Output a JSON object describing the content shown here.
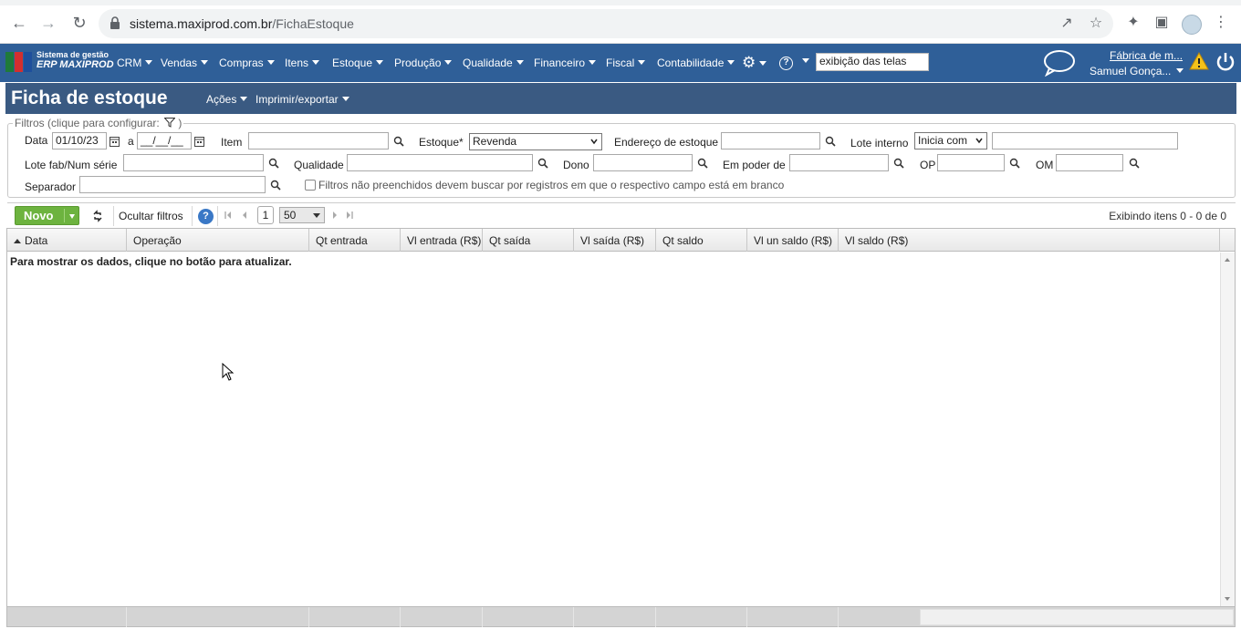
{
  "browser": {
    "url_host": "sistema.maxiprod.com.br",
    "url_path": "/FichaEstoque"
  },
  "app": {
    "logo_line1": "Sistema de gestão",
    "logo_line2": "ERP MAXIPROD",
    "menu": [
      "CRM",
      "Vendas",
      "Compras",
      "Itens",
      "Estoque",
      "Produção",
      "Qualidade",
      "Financeiro",
      "Fiscal",
      "Contabilidade"
    ],
    "nav_search_value": "exibição das telas",
    "company": "Fábrica de m...",
    "user": "Samuel Gonça..."
  },
  "page": {
    "title": "Ficha de estoque",
    "actions_label": "Ações",
    "print_label": "Imprimir/exportar"
  },
  "filters": {
    "legend": "Filtros (clique para configurar:",
    "legend_close": ")",
    "data_label": "Data",
    "data_from": "01/10/23",
    "data_to_sep": "a",
    "data_to": "__/__/__",
    "item_label": "Item",
    "estoque_label": "Estoque*",
    "estoque_value": "Revenda",
    "endereco_label": "Endereço de estoque",
    "lote_interno_label": "Lote interno",
    "lote_interno_mode": "Inicia com",
    "lote_fab_label": "Lote fab/Num série",
    "qualidade_label": "Qualidade",
    "dono_label": "Dono",
    "em_poder_label": "Em poder de",
    "op_label": "OP",
    "om_label": "OM",
    "separador_label": "Separador",
    "blank_filter_label": "Filtros não preenchidos devem buscar por registros em que o respectivo campo está em branco"
  },
  "toolbar": {
    "novo_label": "Novo",
    "hide_filters_label": "Ocultar filtros",
    "page": "1",
    "page_size": "50",
    "paging_info": "Exibindo itens 0 - 0 de 0"
  },
  "grid": {
    "columns": [
      "Data",
      "Operação",
      "Qt entrada",
      "Vl entrada (R$)",
      "Qt saída",
      "Vl saída (R$)",
      "Qt saldo",
      "Vl un saldo (R$)",
      "Vl saldo (R$)"
    ],
    "empty_message": "Para mostrar os dados, clique no botão para atualizar."
  },
  "colors": {
    "nav_bg": "#2f5f98",
    "header_bg": "#3a5a82",
    "novo_green": "#6db33f"
  }
}
